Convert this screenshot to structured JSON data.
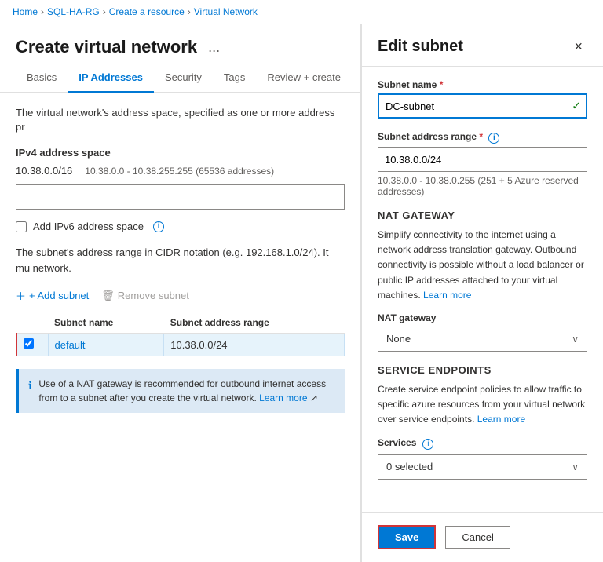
{
  "breadcrumb": {
    "items": [
      "Home",
      "SQL-HA-RG",
      "Create a resource",
      "Virtual Network"
    ]
  },
  "page": {
    "title": "Create virtual network",
    "ellipsis": "...",
    "tabs": [
      {
        "id": "basics",
        "label": "Basics",
        "active": false
      },
      {
        "id": "ip-addresses",
        "label": "IP Addresses",
        "active": true
      },
      {
        "id": "security",
        "label": "Security",
        "active": false
      },
      {
        "id": "tags",
        "label": "Tags",
        "active": false
      },
      {
        "id": "review",
        "label": "Review + create",
        "active": false
      }
    ]
  },
  "left": {
    "description": "The virtual network's address space, specified as one or more address pr",
    "ipv4_section": "IPv4 address space",
    "ipv4_value": "10.38.0.0/16",
    "ipv4_range": "10.38.0.0 - 10.38.255.255 (65536 addresses)",
    "ipv6_checkbox_label": "Add IPv6 address space",
    "cidr_note": "The subnet's address range in CIDR notation (e.g. 192.168.1.0/24). It mu network.",
    "add_subnet": "+ Add subnet",
    "remove_subnet": "Remove subnet",
    "table_headers": [
      "Subnet name",
      "Subnet address range"
    ],
    "subnets": [
      {
        "name": "default",
        "range": "10.38.0.0/24"
      }
    ],
    "nat_notice": "Use of a NAT gateway is recommended for outbound internet access from to a subnet after you create the virtual network.",
    "learn_more": "Learn more"
  },
  "right": {
    "title": "Edit subnet",
    "close": "×",
    "subnet_name_label": "Subnet name",
    "subnet_name_value": "DC-subnet",
    "subnet_name_placeholder": "DC-subnet",
    "subnet_address_label": "Subnet address range",
    "subnet_address_value": "10.38.0.0/24",
    "subnet_address_note": "10.38.0.0 - 10.38.0.255 (251 + 5 Azure reserved addresses)",
    "nat_gateway_section": "NAT GATEWAY",
    "nat_gateway_desc_1": "Simplify connectivity to the internet using a network address translation gateway. Outbound connectivity is possible without a load balancer or public IP addresses attached to your virtual machines.",
    "nat_gateway_learn_more": "Learn more",
    "nat_gateway_label": "NAT gateway",
    "nat_gateway_value": "None",
    "service_endpoints_section": "SERVICE ENDPOINTS",
    "service_endpoints_desc": "Create service endpoint policies to allow traffic to specific azure resources from your virtual network over service endpoints.",
    "service_endpoints_learn_more": "Learn more",
    "services_label": "Services",
    "services_value": "0 selected",
    "save_label": "Save",
    "cancel_label": "Cancel"
  }
}
